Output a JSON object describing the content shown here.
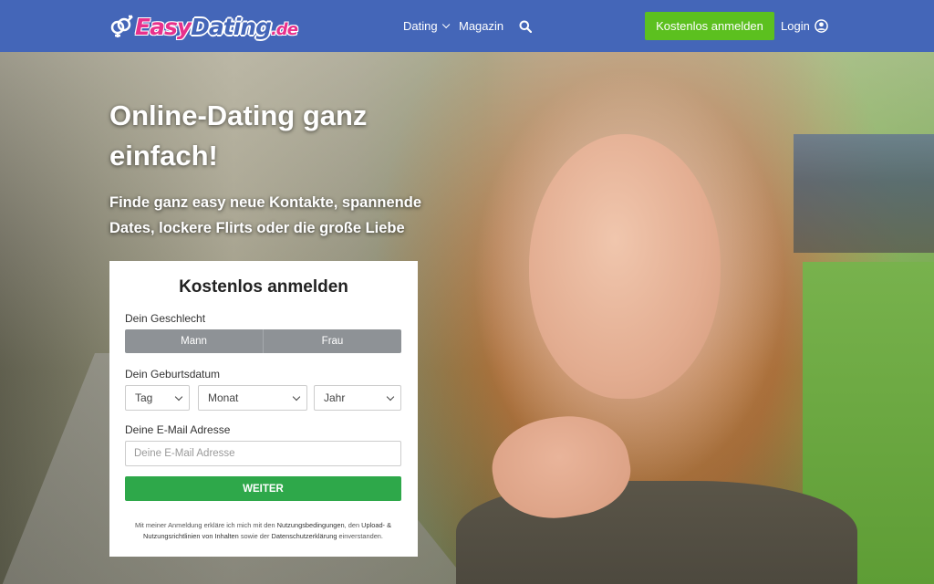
{
  "header": {
    "logo": {
      "easy": "Easy",
      "dating": "Dating",
      "tld": ".de"
    },
    "nav": {
      "dating": "Dating",
      "magazin": "Magazin"
    },
    "signup_button": "Kostenlos anmelden",
    "login": "Login"
  },
  "hero": {
    "title": "Online-Dating ganz einfach!",
    "subtitle": "Finde ganz easy neue Kontakte, spannende Dates, lockere Flirts oder die große Liebe"
  },
  "form": {
    "title": "Kostenlos anmelden",
    "gender_label": "Dein Geschlecht",
    "gender_options": [
      "Mann",
      "Frau"
    ],
    "birthdate_label": "Dein Geburtsdatum",
    "day": "Tag",
    "month": "Monat",
    "year": "Jahr",
    "email_label": "Deine E-Mail Adresse",
    "email_placeholder": "Deine E-Mail Adresse",
    "submit": "WEITER",
    "legal": {
      "t1": "Mit meiner Anmeldung erkläre ich mich mit den ",
      "l1": "Nutzungsbedingungen",
      "t2": ", den ",
      "l2": "Upload- & Nutzungsrichtlinien von Inhalten",
      "t3": " sowie der ",
      "l3": "Datenschutzerklärung",
      "t4": " einverstanden."
    }
  },
  "colors": {
    "header_bg": "#4466b8",
    "signup_green": "#5cc01f",
    "submit_green": "#2ea84a",
    "segment_gray": "#8e9296",
    "logo_pink": "#e8318c"
  },
  "icons": {
    "logo": "gender-symbols-icon",
    "dropdown": "chevron-down-icon",
    "search": "search-icon",
    "login": "user-circle-icon"
  }
}
